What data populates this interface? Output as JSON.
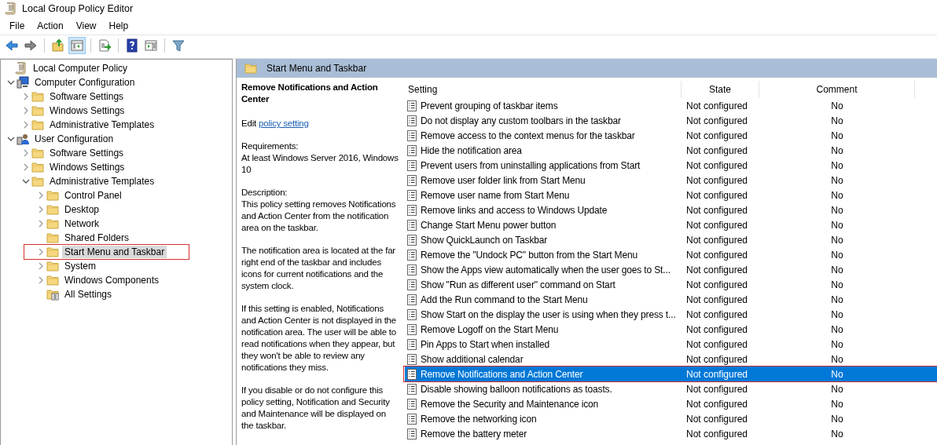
{
  "window": {
    "title": "Local Group Policy Editor"
  },
  "menu": [
    "File",
    "Action",
    "View",
    "Help"
  ],
  "toolbar": [
    {
      "kind": "back",
      "pressed": false
    },
    {
      "kind": "forward",
      "pressed": false
    },
    {
      "kind": "separator"
    },
    {
      "kind": "up",
      "pressed": false
    },
    {
      "kind": "tree",
      "pressed": true
    },
    {
      "kind": "separator"
    },
    {
      "kind": "export",
      "pressed": false
    },
    {
      "kind": "separator"
    },
    {
      "kind": "help",
      "pressed": false
    },
    {
      "kind": "pane",
      "pressed": false
    },
    {
      "kind": "separator"
    },
    {
      "kind": "filter",
      "pressed": false
    }
  ],
  "tree": [
    {
      "label": "Local Computer Policy",
      "kind": "policy",
      "selected": false,
      "children": [
        {
          "label": "Computer Configuration",
          "kind": "computer",
          "expanded": true,
          "selected": false,
          "children": [
            {
              "label": "Software Settings",
              "kind": "folder",
              "expanded": false,
              "selected": false
            },
            {
              "label": "Windows Settings",
              "kind": "folder",
              "expanded": false,
              "selected": false
            },
            {
              "label": "Administrative Templates",
              "kind": "folder",
              "expanded": false,
              "selected": false
            }
          ]
        },
        {
          "label": "User Configuration",
          "kind": "user",
          "expanded": true,
          "selected": false,
          "children": [
            {
              "label": "Software Settings",
              "kind": "folder",
              "expanded": false,
              "selected": false
            },
            {
              "label": "Windows Settings",
              "kind": "folder",
              "expanded": false,
              "selected": false
            },
            {
              "label": "Administrative Templates",
              "kind": "folder",
              "expanded": true,
              "selected": false,
              "children": [
                {
                  "label": "Control Panel",
                  "kind": "folder",
                  "expanded": false,
                  "selected": false
                },
                {
                  "label": "Desktop",
                  "kind": "folder",
                  "expanded": false,
                  "selected": false
                },
                {
                  "label": "Network",
                  "kind": "folder",
                  "expanded": false,
                  "selected": false
                },
                {
                  "label": "Shared Folders",
                  "kind": "folder",
                  "selected": false
                },
                {
                  "label": "Start Menu and Taskbar",
                  "kind": "folder",
                  "expanded": false,
                  "selected": true
                },
                {
                  "label": "System",
                  "kind": "folder",
                  "expanded": false,
                  "selected": false
                },
                {
                  "label": "Windows Components",
                  "kind": "folder",
                  "expanded": false,
                  "selected": false
                },
                {
                  "label": "All Settings",
                  "kind": "all-settings",
                  "selected": false
                }
              ]
            }
          ]
        }
      ]
    }
  ],
  "pane_header": "Start Menu and Taskbar",
  "description": {
    "title": "Remove Notifications and Action Center",
    "edit_prefix": "Edit",
    "edit_link": "policy setting",
    "requirements_label": "Requirements:",
    "requirements": "At least Windows Server 2016, Windows 10",
    "description_label": "Description:",
    "paragraphs": [
      "This policy setting removes Notifications and Action Center from the notification area on the taskbar.",
      "The notification area is located at the far right end of the taskbar and includes icons for current notifications and the system clock.",
      "If this setting is enabled, Notifications and Action Center is not displayed in the notification area. The user will be able to read notifications when they appear, but they won't be able to review any notifications they miss.",
      "If you disable or do not configure this policy setting, Notification and Security and Maintenance will be displayed on the taskbar."
    ]
  },
  "table": {
    "columns": [
      "Setting",
      "State",
      "Comment"
    ],
    "rows": [
      {
        "setting": "Prevent grouping of taskbar items",
        "state": "Not configured",
        "comment": "No",
        "selected": false
      },
      {
        "setting": "Do not display any custom toolbars in the taskbar",
        "state": "Not configured",
        "comment": "No",
        "selected": false
      },
      {
        "setting": "Remove access to the context menus for the taskbar",
        "state": "Not configured",
        "comment": "No",
        "selected": false
      },
      {
        "setting": "Hide the notification area",
        "state": "Not configured",
        "comment": "No",
        "selected": false
      },
      {
        "setting": "Prevent users from uninstalling applications from Start",
        "state": "Not configured",
        "comment": "No",
        "selected": false
      },
      {
        "setting": "Remove user folder link from Start Menu",
        "state": "Not configured",
        "comment": "No",
        "selected": false
      },
      {
        "setting": "Remove user name from Start Menu",
        "state": "Not configured",
        "comment": "No",
        "selected": false
      },
      {
        "setting": "Remove links and access to Windows Update",
        "state": "Not configured",
        "comment": "No",
        "selected": false
      },
      {
        "setting": "Change Start Menu power button",
        "state": "Not configured",
        "comment": "No",
        "selected": false
      },
      {
        "setting": "Show QuickLaunch on Taskbar",
        "state": "Not configured",
        "comment": "No",
        "selected": false
      },
      {
        "setting": "Remove the \"Undock PC\" button from the Start Menu",
        "state": "Not configured",
        "comment": "No",
        "selected": false
      },
      {
        "setting": "Show the Apps view automatically when the user goes to St...",
        "state": "Not configured",
        "comment": "No",
        "selected": false
      },
      {
        "setting": "Show \"Run as different user\" command on Start",
        "state": "Not configured",
        "comment": "No",
        "selected": false
      },
      {
        "setting": "Add the Run command to the Start Menu",
        "state": "Not configured",
        "comment": "No",
        "selected": false
      },
      {
        "setting": "Show Start on the display the user is using when they press t...",
        "state": "Not configured",
        "comment": "No",
        "selected": false
      },
      {
        "setting": "Remove Logoff on the Start Menu",
        "state": "Not configured",
        "comment": "No",
        "selected": false
      },
      {
        "setting": "Pin Apps to Start when installed",
        "state": "Not configured",
        "comment": "No",
        "selected": false
      },
      {
        "setting": "Show additional calendar",
        "state": "Not configured",
        "comment": "No",
        "selected": false
      },
      {
        "setting": "Remove Notifications and Action Center",
        "state": "Not configured",
        "comment": "No",
        "selected": true
      },
      {
        "setting": "Disable showing balloon notifications as toasts.",
        "state": "Not configured",
        "comment": "No",
        "selected": false
      },
      {
        "setting": "Remove the Security and Maintenance icon",
        "state": "Not configured",
        "comment": "No",
        "selected": false
      },
      {
        "setting": "Remove the networking icon",
        "state": "Not configured",
        "comment": "No",
        "selected": false
      },
      {
        "setting": "Remove the battery meter",
        "state": "Not configured",
        "comment": "No",
        "selected": false
      }
    ]
  }
}
